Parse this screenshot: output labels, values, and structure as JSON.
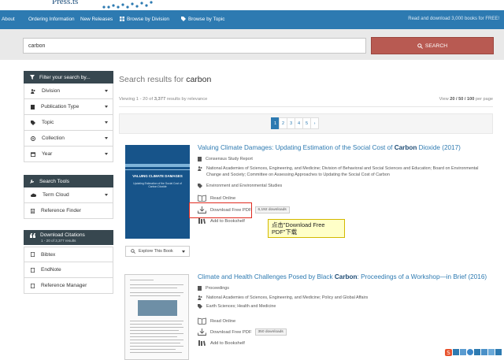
{
  "logo": {
    "text": "Press.ts"
  },
  "topnav": {
    "items": [
      "About",
      "Ordering Information",
      "New Releases",
      "Browse by Division",
      "Browse by Topic"
    ],
    "right_text": "Read and download 3,000 books for FREE!"
  },
  "search": {
    "value": "carbon",
    "button_label": "SEARCH"
  },
  "sidebar": {
    "filter_header": "Filter your search by...",
    "filters": [
      "Division",
      "Publication Type",
      "Topic",
      "Collection",
      "Year"
    ],
    "tools_header": "Search Tools",
    "tools": [
      "Term Cloud",
      "Reference Finder"
    ],
    "citations_header": "Download Citations",
    "citations_sub": "1 - 20 of 3,377 results",
    "citations": [
      "Bibtex",
      "EndNote",
      "Reference Manager"
    ]
  },
  "results": {
    "heading_prefix": "Search results for",
    "heading_term": "carbon",
    "viewing_prefix": "Viewing 1 - 20 of",
    "viewing_count": "3,377",
    "viewing_suffix": "results by relevance",
    "perpage_prefix": "View",
    "perpage_options": "20 / 50 / 100",
    "perpage_suffix": "per page",
    "pages": [
      "1",
      "2",
      "3",
      "4",
      "5",
      "›"
    ],
    "active_page": "1"
  },
  "result1": {
    "title_before": "Valuing Climate Damages: Updating Estimation of the Social Cost of",
    "title_term": "Carbon",
    "title_after": "Dioxide (2017)",
    "type": "Consensus Study Report",
    "authors": "National Academies of Sciences, Engineering, and Medicine; Division of Behavioral and Social Sciences and Education; Board on Environmental Change and Society; Committee on Assessing Approaches to Updating the Social Cost of Carbon",
    "topic": "Environment and Environmental Studies",
    "read_online": "Read Online",
    "download_pdf": "Download Free PDF",
    "downloads": "6,192 downloads",
    "add_bookshelf": "Add to Bookshelf",
    "explore": "Explore This Book",
    "cover_title": "VALUING CLIMATE DAMAGES",
    "cover_sub": "Updating Estimation of the Social Cost of Carbon Dioxide"
  },
  "callout": {
    "text": "点击\"Download Free PDF\"下载"
  },
  "result2": {
    "title_before": "Climate and Health Challenges Posed by Black",
    "title_term": "Carbon",
    "title_after": ": Proceedings of a Workshop—in Brief (2016)",
    "type": "Proceedings",
    "authors": "National Academies of Sciences, Engineering, and Medicine; Policy and Global Affairs",
    "topic": "Earth Sciences; Health and Medicine",
    "read_online": "Read Online",
    "download_pdf": "Download Free PDF",
    "downloads": "350 downloads",
    "add_bookshelf": "Add to Bookshelf"
  }
}
